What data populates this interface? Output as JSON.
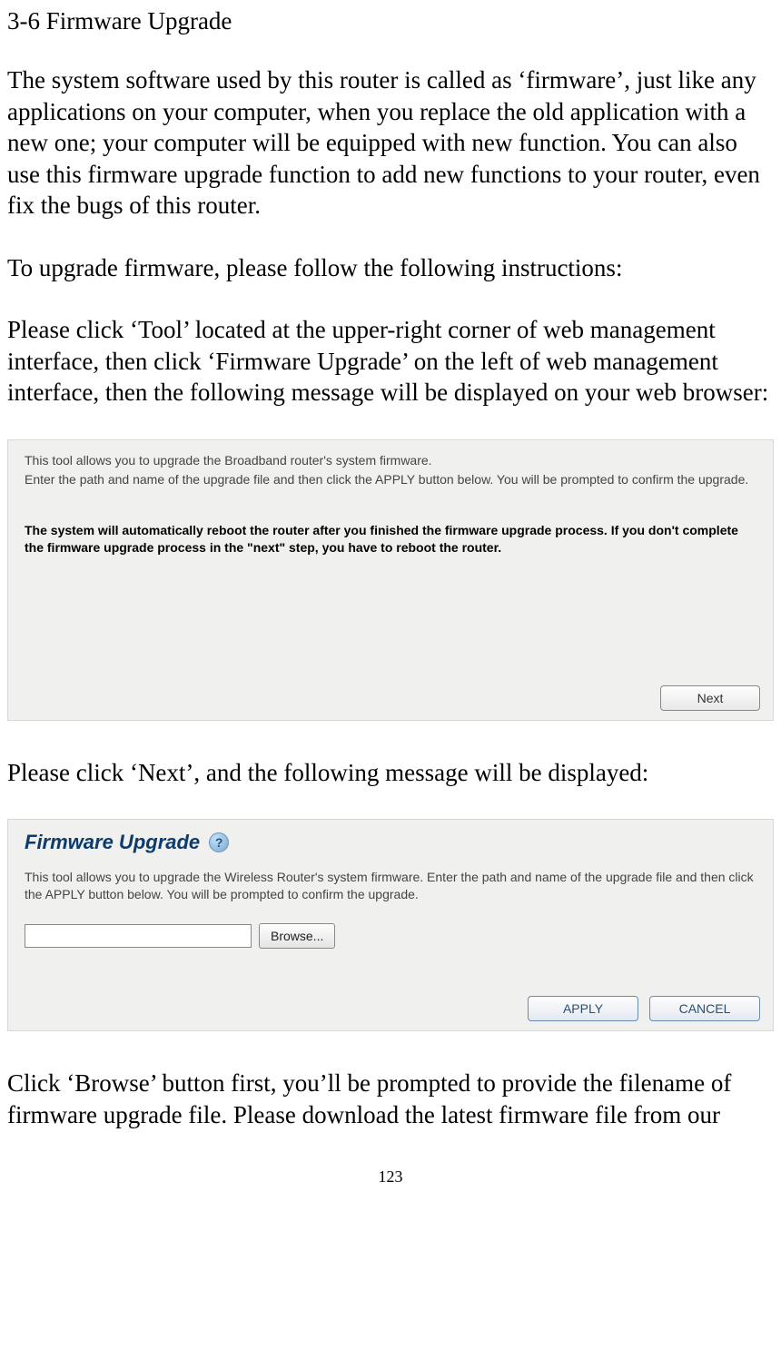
{
  "heading": "3-6 Firmware Upgrade",
  "para1": "The system software used by this router is called as ‘firmware’, just like any applications on your computer, when you replace the old application with a new one; your computer will be equipped with new function. You can also use this firmware upgrade function to add new functions to your router, even fix the bugs of this router.",
  "para2": "To upgrade firmware, please follow the following instructions:",
  "para3": "Please click ‘Tool’ located at the upper-right corner of web management interface, then click ‘Firmware Upgrade’ on the left of web management interface, then the following message will be displayed on your web browser:",
  "shot1": {
    "line1": "This tool allows you to upgrade the Broadband router's system firmware.",
    "line2": "Enter the path and name of the upgrade file and then click the APPLY button below.  You will be prompted to confirm the upgrade.",
    "warn": "The system will automatically reboot the router after you finished the firmware upgrade process. If you don't complete the firmware upgrade process in the \"next\" step, you have to reboot the router.",
    "next_label": "Next"
  },
  "para4": "Please click ‘Next’, and the following message will be displayed:",
  "shot2": {
    "title": "Firmware Upgrade",
    "help_glyph": "?",
    "desc": "This tool allows you to upgrade the Wireless Router's system firmware. Enter the path and name of the upgrade file and then click the APPLY button below.  You will be prompted to confirm the upgrade.",
    "file_value": "",
    "browse_label": "Browse...",
    "apply_label": "APPLY",
    "cancel_label": "CANCEL"
  },
  "para5": "Click ‘Browse’ button first, you’ll be prompted to provide the filename of firmware upgrade file. Please download the latest firmware file from our",
  "page_number": "123"
}
